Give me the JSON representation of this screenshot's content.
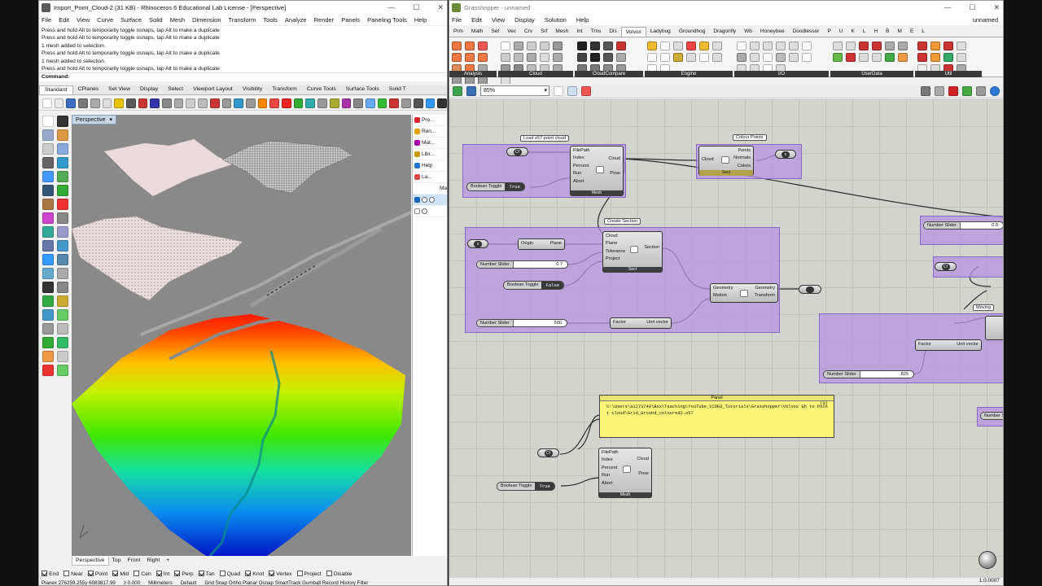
{
  "rhino": {
    "title": "Import_Point_Cloud-2 (31 KB) - Rhinoceros 6 Educational Lab License - [Perspective]",
    "menu": [
      "File",
      "Edit",
      "View",
      "Curve",
      "Surface",
      "Solid",
      "Mesh",
      "Dimension",
      "Transform",
      "Tools",
      "Analyze",
      "Render",
      "Panels",
      "Paneling Tools",
      "Help"
    ],
    "history": [
      "Press and hold Alt to temporarily toggle osnaps, tap Alt to make a duplicate",
      "Press and hold Alt to temporarily toggle osnaps, tap Alt to make a duplicate",
      "1 mesh added to selection.",
      "Press and hold Alt to temporarily toggle osnaps, tap Alt to make a duplicate",
      "1 mesh added to selection.",
      "Press and hold Alt to temporarily toggle osnaps, tap Alt to make a duplicate"
    ],
    "command_label": "Command:",
    "tabs": [
      "Standard",
      "CPlanes",
      "Set View",
      "Display",
      "Select",
      "Viewport Layout",
      "Visibility",
      "Transform",
      "Curve Tools",
      "Surface Tools",
      "Solid T"
    ],
    "viewport_label": "Perspective",
    "panels": [
      "Pro...",
      "Ren...",
      "Mat...",
      "Libr...",
      "Help",
      "La..."
    ],
    "panel_col": "Ma",
    "viewport_tabs": [
      "Perspective",
      "Top",
      "Front",
      "Right"
    ],
    "viewport_add": "+",
    "osnaps": [
      {
        "label": "End",
        "checked": true
      },
      {
        "label": "Near",
        "checked": false
      },
      {
        "label": "Point",
        "checked": true
      },
      {
        "label": "Mid",
        "checked": true
      },
      {
        "label": "Cen",
        "checked": false
      },
      {
        "label": "Int",
        "checked": true
      },
      {
        "label": "Perp",
        "checked": true
      },
      {
        "label": "Tan",
        "checked": true
      },
      {
        "label": "Quad",
        "checked": false
      },
      {
        "label": "Knot",
        "checked": true
      },
      {
        "label": "Vertex",
        "checked": true
      },
      {
        "label": "Project",
        "checked": false
      },
      {
        "label": "Disable",
        "checked": false
      }
    ],
    "status": {
      "cplane": "Planex 276259.255y 6083817.99",
      "z": "z 0.000",
      "units": "Millimeters",
      "layer": "Default",
      "modes": "Grid Snap Ortho Planar Osnap SmartTrack Gumball Record History Filter"
    }
  },
  "grasshopper": {
    "title": "Grasshopper - unnamed",
    "doc_name": "unnamed",
    "menu": [
      "File",
      "Edit",
      "View",
      "Display",
      "Solution",
      "Help"
    ],
    "tabs": [
      "Prm",
      "Math",
      "Set",
      "Vec",
      "Crv",
      "Srf",
      "Mesh",
      "Int",
      "Trns",
      "Dis",
      "Volvox",
      "Ladybug",
      "Groundhog",
      "Dragonfly",
      "Wb",
      "Honeybee",
      "Doodlessor",
      "P",
      "U",
      "K",
      "L",
      "H",
      "B",
      "M",
      "E",
      "L"
    ],
    "active_tab": "Volvox",
    "ribbon_groups": [
      "Analysis",
      "Cloud",
      "CloudCompare",
      "Engine",
      "I/O",
      "UserData",
      "Util"
    ],
    "zoom": "85%",
    "version": "1.0.0007",
    "groups": {
      "load_e57": "Load e57 point cloud",
      "color_points": "Colour Points",
      "create_section": "Create Section",
      "moving": "Moving",
      "panel": "Panel"
    },
    "load_comp": {
      "inputs": [
        "FilePath",
        "Index",
        "Percent",
        "Run",
        "Abort"
      ],
      "outputs": [
        "Cloud",
        "Pose"
      ],
      "name": "Mesh",
      "badge": "e57"
    },
    "color_comp": {
      "inputs": [
        "Cloud"
      ],
      "outputs": [
        "Points",
        "Normals",
        "Colors"
      ],
      "name": "Sect",
      "badge": "e57"
    },
    "section_comp": {
      "inputs": [
        "Cloud",
        "Plane",
        "Tolerance",
        "Project"
      ],
      "outputs": [
        "Section"
      ],
      "name": "Sect"
    },
    "move_comp": {
      "inputs": [
        "Geometry",
        "Motion"
      ],
      "outputs": [
        "Geometry",
        "Transform"
      ]
    },
    "vector_comp": {
      "inputs": [
        "Factor"
      ],
      "outputs": [
        "Unit vector"
      ]
    },
    "plane_comp": {
      "inputs": [
        "Origin"
      ],
      "outputs": [
        "Plane"
      ]
    },
    "load2_comp": {
      "inputs": [
        "FilePath",
        "Index",
        "Percent",
        "Run",
        "Abort"
      ],
      "outputs": [
        "Cloud",
        "Pose"
      ],
      "name": "Mesh"
    },
    "toggles": [
      {
        "label": "Boolean Toggle",
        "value": "True"
      },
      {
        "label": "Boolean Toggle",
        "value": "False"
      },
      {
        "label": "Boolean Toggle",
        "value": "True"
      }
    ],
    "sliders": [
      {
        "label": "Number Slider",
        "value": "0.7"
      },
      {
        "label": "Number Slider",
        "value": "500"
      },
      {
        "label": "Number Slider",
        "value": "0.8"
      },
      {
        "label": "Number Slider",
        "value": "825"
      },
      {
        "label": "Number S",
        "value": ""
      }
    ],
    "panel_text": "C:\\Users\\a1273740\\Box\\Teaching\\YouTube_VIDEO_Tutorials\\Grasshopper\\Volvox Gh to Point cloud\\Grid_Ground_coloured2.e57",
    "panel_count": "(0)",
    "param_labels": {
      "cf": "Cf",
      "x": "x"
    }
  }
}
